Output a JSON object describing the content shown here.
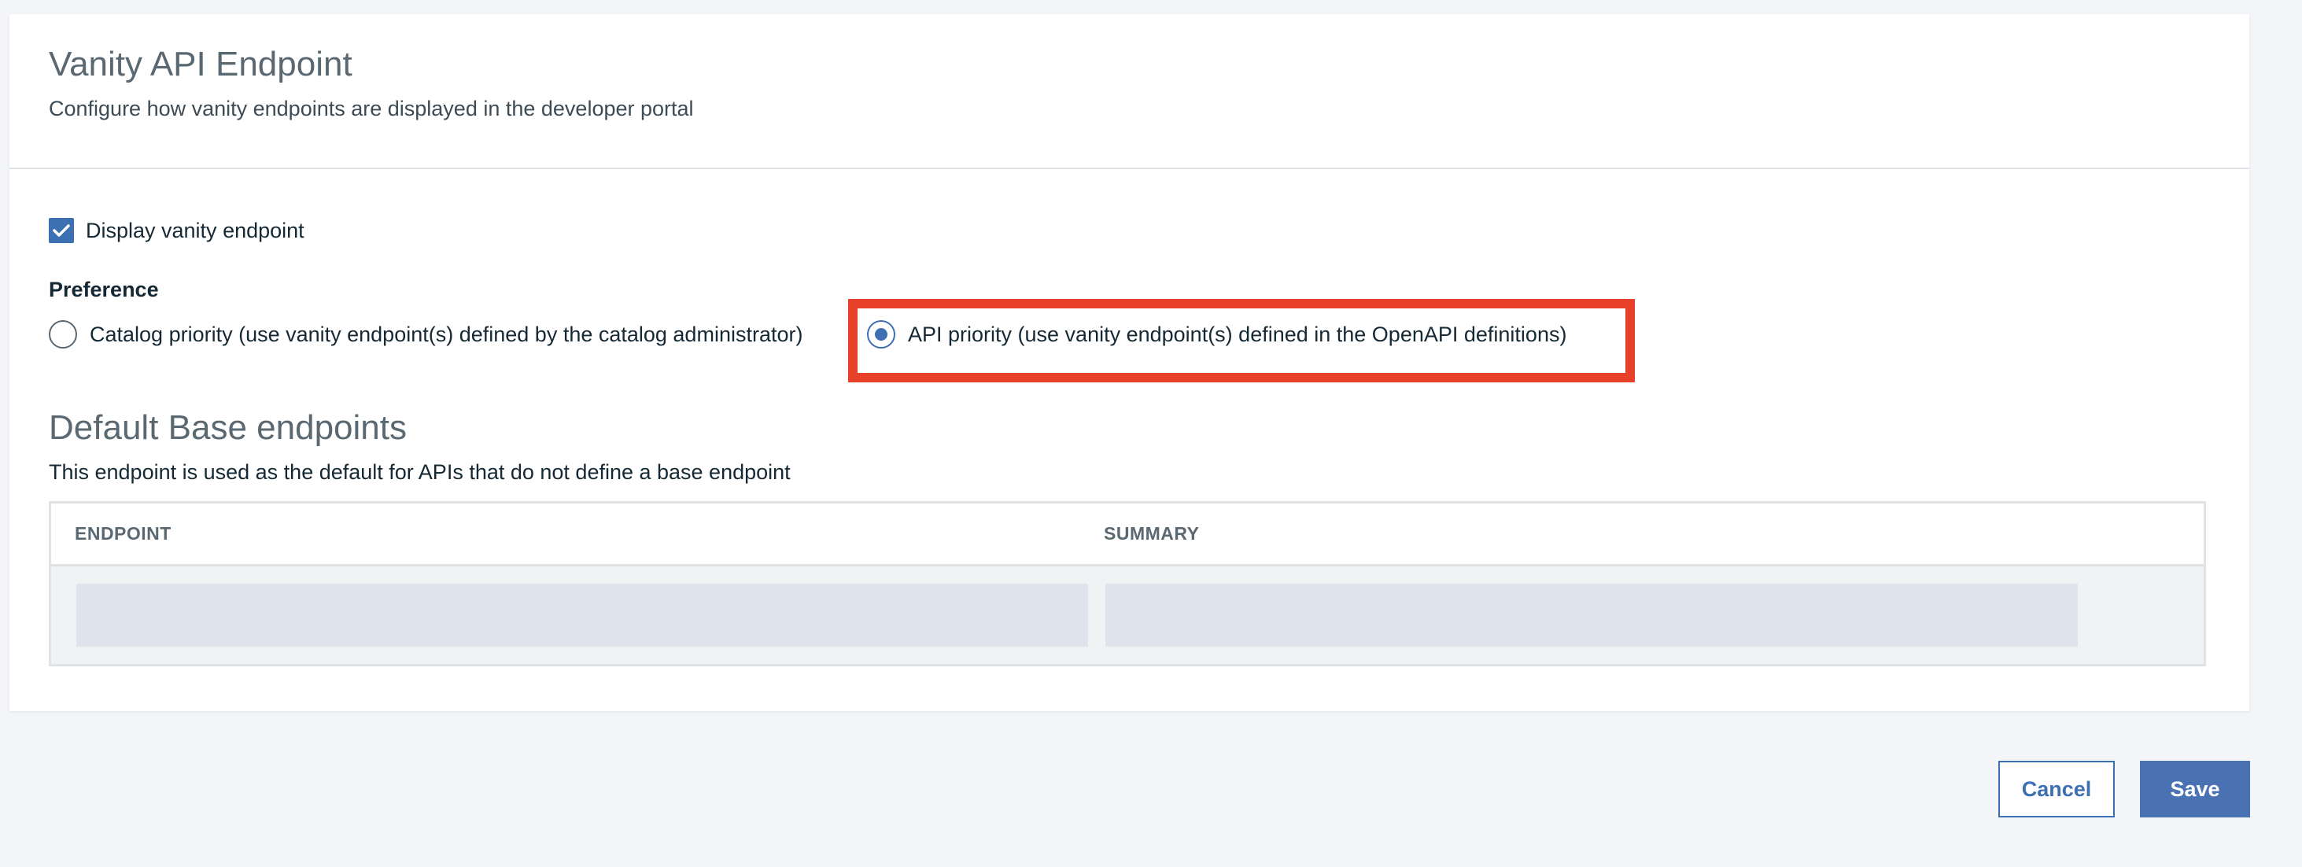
{
  "header": {
    "title": "Vanity API Endpoint",
    "description": "Configure how vanity endpoints are displayed in the developer portal"
  },
  "display_vanity": {
    "label": "Display vanity endpoint",
    "checked": true
  },
  "preference": {
    "label": "Preference",
    "options": [
      {
        "label": "Catalog priority (use vanity endpoint(s) defined by the catalog administrator)",
        "selected": false
      },
      {
        "label": "API priority (use vanity endpoint(s) defined in the OpenAPI definitions)",
        "selected": true
      }
    ]
  },
  "base_endpoints": {
    "title": "Default Base endpoints",
    "description": "This endpoint is used as the default for APIs that do not define a base endpoint",
    "columns": [
      "ENDPOINT",
      "SUMMARY"
    ]
  },
  "actions": {
    "cancel_label": "Cancel",
    "save_label": "Save"
  },
  "colors": {
    "accent": "#3d70b2",
    "highlight": "#e8412a"
  }
}
